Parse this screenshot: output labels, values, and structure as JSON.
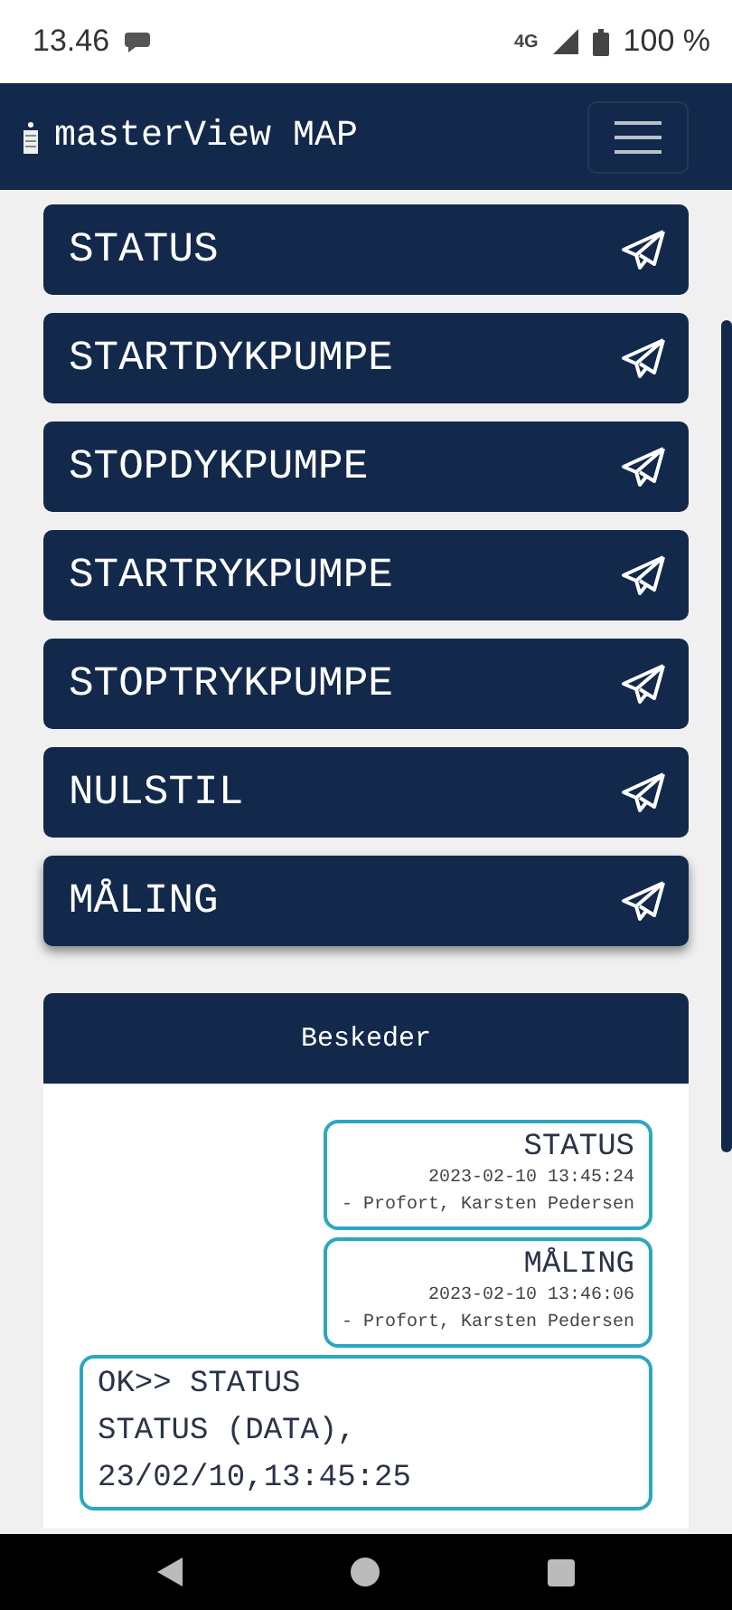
{
  "status_bar": {
    "time": "13.46",
    "network": "4G",
    "battery": "100 %"
  },
  "header": {
    "title": "masterView MAP"
  },
  "commands": [
    {
      "label": "STATUS",
      "selected": false
    },
    {
      "label": "STARTDYKPUMPE",
      "selected": false
    },
    {
      "label": "STOPDYKPUMPE",
      "selected": false
    },
    {
      "label": "STARTRYKPUMPE",
      "selected": false
    },
    {
      "label": "STOPTRYKPUMPE",
      "selected": false
    },
    {
      "label": "NULSTIL",
      "selected": false
    },
    {
      "label": "MÅLING",
      "selected": true
    }
  ],
  "messages_panel": {
    "title": "Beskeder",
    "messages": [
      {
        "kind": "sent",
        "text": "STATUS",
        "time": "2023-02-10 13:45:24",
        "author": "- Profort, Karsten Pedersen"
      },
      {
        "kind": "sent",
        "text": "MÅLING",
        "time": "2023-02-10 13:46:06",
        "author": "- Profort, Karsten Pedersen"
      },
      {
        "kind": "received",
        "lines": [
          "OK>> STATUS",
          "STATUS (DATA),",
          "23/02/10,13:45:25"
        ]
      }
    ]
  }
}
